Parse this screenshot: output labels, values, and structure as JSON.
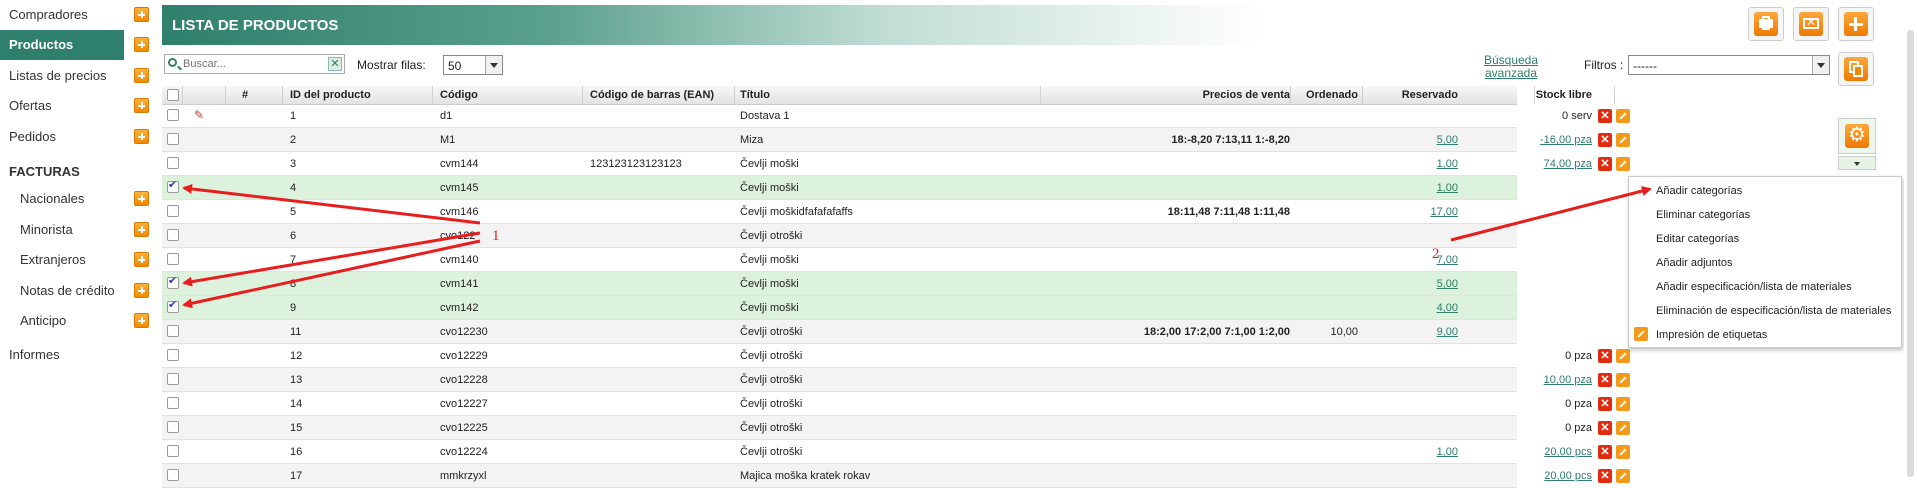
{
  "sidebar": {
    "items": [
      {
        "label": "Compradores",
        "has_add": true
      },
      {
        "label": "Productos",
        "has_add": true,
        "active": true
      },
      {
        "label": "Listas de precios",
        "has_add": true
      },
      {
        "label": "Ofertas",
        "has_add": true
      },
      {
        "label": "Pedidos",
        "has_add": true
      }
    ],
    "facturas_heading": "FACTURAS",
    "facturas_items": [
      {
        "label": "Nacionales",
        "has_add": true
      },
      {
        "label": "Minorista",
        "has_add": true
      },
      {
        "label": "Extranjeros",
        "has_add": true
      },
      {
        "label": "Notas de crédito",
        "has_add": true
      },
      {
        "label": "Anticipo",
        "has_add": true
      }
    ],
    "informes": "Informes"
  },
  "header": {
    "title": "LISTA DE PRODUCTOS",
    "buttons": [
      "print-icon",
      "mail-icon",
      "add-icon",
      "copy-icon"
    ]
  },
  "filters": {
    "search_placeholder": "Buscar...",
    "rows_label": "Mostrar filas:",
    "rows_value": "50",
    "advanced_search": "Búsqueda avanzada",
    "filters_label": "Filtros :",
    "filters_value": "------"
  },
  "table": {
    "columns": [
      "#",
      "ID del producto",
      "Código",
      "Código de barras (EAN)",
      "Título",
      "Precios de venta",
      "Ordenado",
      "Reservado",
      "Stock libre"
    ],
    "rows": [
      {
        "id": "1",
        "code": "d1",
        "ean": "",
        "title": "Dostava 1",
        "prices": "",
        "ordered": "",
        "reserved": "",
        "stock": "0 serv",
        "stock_link": false,
        "checked": false,
        "attachment": true
      },
      {
        "id": "2",
        "code": "M1",
        "ean": "",
        "title": "Miza",
        "prices": "18:-8,20 7:13,11 1:-8,20",
        "ordered": "",
        "reserved": "5,00",
        "stock": "-16,00 pza",
        "stock_link": true,
        "checked": false
      },
      {
        "id": "3",
        "code": "cvm144",
        "ean": "123123123123123",
        "title": "Čevlji moški",
        "prices": "",
        "ordered": "",
        "reserved": "1,00",
        "stock": "74,00 pza",
        "stock_link": true,
        "checked": false
      },
      {
        "id": "4",
        "code": "cvm145",
        "ean": "",
        "title": "Čevlji moški",
        "prices": "",
        "ordered": "",
        "reserved": "1,00",
        "stock": "",
        "stock_link": false,
        "checked": true
      },
      {
        "id": "5",
        "code": "cvm146",
        "ean": "",
        "title": "Čevlji moškidfafafafaffs",
        "prices": "18:11,48 7:11,48 1:11,48",
        "ordered": "",
        "reserved": "17,00",
        "stock": "",
        "stock_link": false,
        "checked": false
      },
      {
        "id": "6",
        "code": "cvo122",
        "ean": "",
        "title": "Čevlji otroški",
        "prices": "",
        "ordered": "",
        "reserved": "",
        "stock": "",
        "stock_link": false,
        "checked": false
      },
      {
        "id": "7",
        "code": "cvm140",
        "ean": "",
        "title": "Čevlji moški",
        "prices": "",
        "ordered": "",
        "reserved": "7,00",
        "stock": "",
        "stock_link": false,
        "checked": false
      },
      {
        "id": "8",
        "code": "cvm141",
        "ean": "",
        "title": "Čevlji moški",
        "prices": "",
        "ordered": "",
        "reserved": "5,00",
        "stock": "",
        "stock_link": false,
        "checked": true
      },
      {
        "id": "9",
        "code": "cvm142",
        "ean": "",
        "title": "Čevlji moški",
        "prices": "",
        "ordered": "",
        "reserved": "4,00",
        "stock": "",
        "stock_link": false,
        "checked": true
      },
      {
        "id": "11",
        "code": "cvo12230",
        "ean": "",
        "title": "Čevlji otroški",
        "prices": "18:2,00 17:2,00 7:1,00 1:2,00",
        "ordered": "10,00",
        "reserved": "9,00",
        "stock": "",
        "stock_link": false,
        "checked": false
      },
      {
        "id": "12",
        "code": "cvo12229",
        "ean": "",
        "title": "Čevlji otroški",
        "prices": "",
        "ordered": "",
        "reserved": "",
        "stock": "0 pza",
        "stock_link": false,
        "checked": false
      },
      {
        "id": "13",
        "code": "cvo12228",
        "ean": "",
        "title": "Čevlji otroški",
        "prices": "",
        "ordered": "",
        "reserved": "",
        "stock": "10,00 pza",
        "stock_link": true,
        "checked": false
      },
      {
        "id": "14",
        "code": "cvo12227",
        "ean": "",
        "title": "Čevlji otroški",
        "prices": "",
        "ordered": "",
        "reserved": "",
        "stock": "0 pza",
        "stock_link": false,
        "checked": false
      },
      {
        "id": "15",
        "code": "cvo12225",
        "ean": "",
        "title": "Čevlji otroški",
        "prices": "",
        "ordered": "",
        "reserved": "",
        "stock": "0 pza",
        "stock_link": false,
        "checked": false
      },
      {
        "id": "16",
        "code": "cvo12224",
        "ean": "",
        "title": "Čevlji otroški",
        "prices": "",
        "ordered": "",
        "reserved": "1,00",
        "stock": "20,00 pcs",
        "stock_link": true,
        "checked": false
      },
      {
        "id": "17",
        "code": "mmkrzyxl",
        "ean": "",
        "title": "Majica moška kratek rokav",
        "prices": "",
        "ordered": "",
        "reserved": "",
        "stock": "20,00 pcs",
        "stock_link": true,
        "checked": false
      }
    ]
  },
  "actions_menu": {
    "items": [
      "Añadir categorías",
      "Eliminar categorías",
      "Editar categorías",
      "Añadir adjuntos",
      "Añadir especificación/lista de materiales",
      "Eliminación de especificación/lista de materiales",
      "Impresión de etiquetas"
    ]
  },
  "annotations": {
    "label_1": "1",
    "label_2": "2"
  },
  "colors": {
    "brand": "#2e7f6b",
    "accent": "#f08a00",
    "selected_row": "#ddf2dd",
    "arrow": "#e81e1e"
  }
}
